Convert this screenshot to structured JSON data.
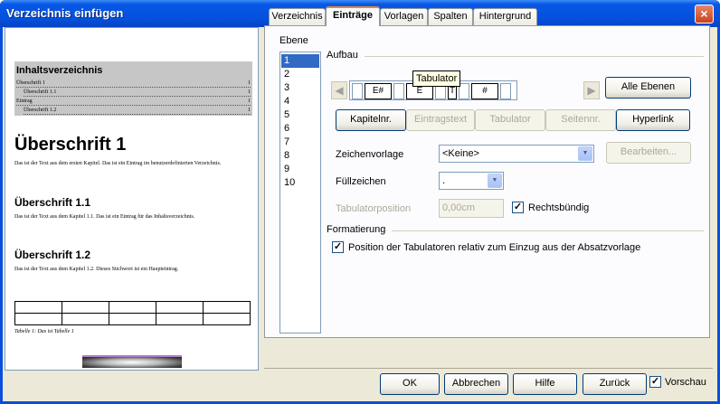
{
  "window": {
    "title": "Verzeichnis einfügen",
    "close_glyph": "×"
  },
  "preview": {
    "header_title": "Inhaltsverzeichnis",
    "toc": [
      {
        "text": "Überschrift 1",
        "page": "1"
      },
      {
        "text": "Überschrift 1.1",
        "page": "1"
      },
      {
        "text": "Eintrag",
        "page": "1"
      },
      {
        "text": "Überschrift 1.2",
        "page": "1"
      }
    ],
    "heading1": "Überschrift 1",
    "para1": "Das ist der Text aus dem ersten Kapitel. Das ist ein Eintrag im benutzerdefinierten Verzeichnis.",
    "heading11": "Überschrift 1.1",
    "para11": "Das ist der Text aus dem Kapitel 1.1. Das ist ein Eintrag für das Inhaltsverzeichnis.",
    "heading12": "Überschrift 1.2",
    "para12": "Das ist der Text aus dem Kapitel 1.2. Dieses Stichwort ist ein Haupteintrag.",
    "caption": "Tabelle 1: Das ist Tabelle 1"
  },
  "tabs": [
    "Verzeichnis",
    "Einträge",
    "Vorlagen",
    "Spalten",
    "Hintergrund"
  ],
  "active_tab": "Einträge",
  "entries": {
    "levels_label": "Ebene",
    "levels": [
      "1",
      "2",
      "3",
      "4",
      "5",
      "6",
      "7",
      "8",
      "9",
      "10"
    ],
    "selected_level": "1",
    "structure_label": "Aufbau",
    "structure_tokens": [
      "E#",
      "E",
      "T",
      "#"
    ],
    "tooltip": "Tabulator",
    "all_levels_button": "Alle Ebenen",
    "buttons": {
      "chapter_no": "Kapitelnr.",
      "entry_text": "Eintragstext",
      "tab_stop": "Tabulator",
      "page_no": "Seitennr.",
      "hyperlink": "Hyperlink"
    },
    "char_style_label": "Zeichenvorlage",
    "char_style_value": "<Keine>",
    "edit_button": "Bearbeiten...",
    "fill_char_label": "Füllzeichen",
    "fill_char_value": ".",
    "tab_position_label": "Tabulatorposition",
    "tab_position_value": "0,00cm",
    "right_aligned_label": "Rechtsbündig",
    "right_aligned_checked": true,
    "format_label": "Formatierung",
    "tab_relative_label": "Position der Tabulatoren relativ zum Einzug aus der Absatzvorlage",
    "tab_relative_checked": true
  },
  "footer": {
    "ok": "OK",
    "cancel": "Abbrechen",
    "help": "Hilfe",
    "back": "Zurück",
    "preview_label": "Vorschau",
    "preview_checked": true
  },
  "check_glyph": "✓"
}
